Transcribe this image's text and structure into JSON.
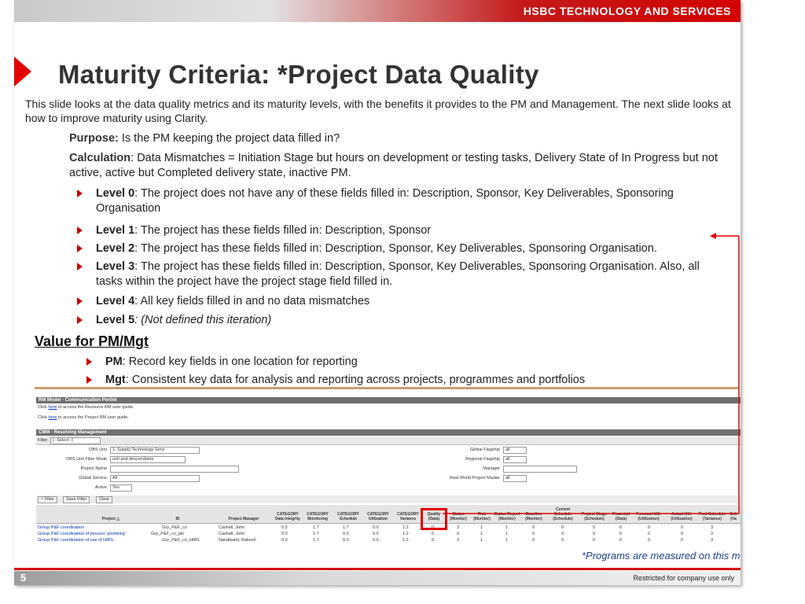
{
  "header": {
    "company": "HSBC TECHNOLOGY AND SERVICES"
  },
  "title": "Maturity Criteria:  *Project Data Quality",
  "intro": "This slide looks at the data quality metrics and its maturity levels, with the benefits it provides to the PM and Management. The next slide looks at how to improve maturity using Clarity.",
  "purpose": {
    "label": "Purpose:",
    "text": " Is the PM keeping the project data filled in?"
  },
  "calculation": {
    "label": "Calculation",
    "text": ": Data Mismatches = Initiation Stage but hours on development or testing tasks, Delivery State of In Progress but not active, active but Completed delivery state, inactive PM."
  },
  "levels": [
    {
      "label": "Level 0",
      "text": ": The project does not have any of these fields filled in: Description, Sponsor, Key Deliverables, Sponsoring Organisation"
    },
    {
      "label": "Level 1",
      "text": ": The project has these fields filled in: Description, Sponsor"
    },
    {
      "label": "Level 2",
      "text": ": The project has these fields filled in:  Description, Sponsor, Key Deliverables, Sponsoring Organisation."
    },
    {
      "label": "Level 3",
      "text": ": The project has these fields filled in: Description, Sponsor, Key Deliverables, Sponsoring Organisation. Also, all tasks within the project have the project stage field filled in."
    },
    {
      "label": "Level 4",
      "text": ": All key fields filled in and no data mismatches"
    },
    {
      "label": "Level 5",
      "text": ": (Not defined this iteration)"
    }
  ],
  "value_heading": "Value for PM/Mgt",
  "value_items": [
    {
      "label": "PM",
      "text": ": Record key fields in one location for reporting"
    },
    {
      "label": "Mgt",
      "text": ": Consistent key data for analysis and reporting across projects, programmes and portfolios"
    }
  ],
  "screenshot": {
    "portlet_title": "RM Model - Communication Portlet",
    "guide1": {
      "pre": "Click ",
      "link": "here",
      "post": " to access the Resource RM user guide."
    },
    "guide2": {
      "pre": "Click ",
      "link": "here",
      "post": " to access the Project RM user guide."
    },
    "cmm_title": "CMM - Resolving Management",
    "filter_label": "Filter",
    "filter_value": "[--Select--]",
    "fields_left": [
      {
        "label": "OBS Unit",
        "value": "1. Supply:Technology Servi"
      },
      {
        "label": "OBS Unit Filter Mode",
        "value": "unit and descendants"
      },
      {
        "label": "Project Name",
        "value": ""
      },
      {
        "label": "Global Service",
        "value": "All"
      },
      {
        "label": "Active",
        "value": "Yes"
      }
    ],
    "fields_right": [
      {
        "label": "Global Flagship",
        "value": "all"
      },
      {
        "label": "Regional Flagship",
        "value": "all"
      },
      {
        "label": "Manager",
        "value": ""
      },
      {
        "label": "Real World Project Master",
        "value": "all"
      }
    ],
    "buttons": [
      "× Filter",
      "Save Filter",
      "Clear"
    ],
    "columns": [
      "Project △",
      "ID",
      "Project Manager",
      "CATEGORY Data Integrity",
      "CATEGORY Monitoring",
      "CATEGORY Schedule",
      "CATEGORY Utilization",
      "CATEGORY Variance",
      "Quality (Data)",
      "Status (Monitor)",
      "Risk (Monitor)",
      "Status Report (Monitor)",
      "Baseline (Monitor)",
      "Current Schedule (Schedule)",
      "Project Stage (Schedule)",
      "Financial (Data)",
      "Forecast Util. (Utilization)",
      "Actual Util. (Utilization)",
      "Post Schedule (Variance)",
      "Sch (Va"
    ],
    "rows": [
      [
        "Group P&F coordination",
        "Grp_P&F_co",
        "Cashell, John",
        "0.5",
        "1.7",
        "1.7",
        "0.0",
        "1.2",
        "0",
        "3",
        "1",
        "1",
        "0",
        "0",
        "5",
        "0",
        "0",
        "0",
        "3",
        ""
      ],
      [
        "Group P&F coordination of process 'plumbing'",
        "Grp_P&F_co_pln",
        "Cashell, John",
        "0.0",
        "1.7",
        "0.0",
        "0.0",
        "1.2",
        "0",
        "3",
        "1",
        "1",
        "0",
        "0",
        "0",
        "0",
        "0",
        "0",
        "3",
        ""
      ],
      [
        "Group P&F coordination of use of HIBS",
        "Grp_P&F_co_HIBS",
        "Nandikanti, Rakesh",
        "0.0",
        "1.7",
        "0.0",
        "0.0",
        "1.2",
        "0",
        "3",
        "1",
        "1",
        "0",
        "0",
        "0",
        "0",
        "0",
        "0",
        "3",
        ""
      ]
    ]
  },
  "note": "*Programs are measured on this metric",
  "footer": {
    "page_number": "5",
    "classification": "Restricted for company use only"
  },
  "colors": {
    "brand_red": "#d40000",
    "title_gray": "#333333",
    "note_blue": "#1f3f8f"
  }
}
